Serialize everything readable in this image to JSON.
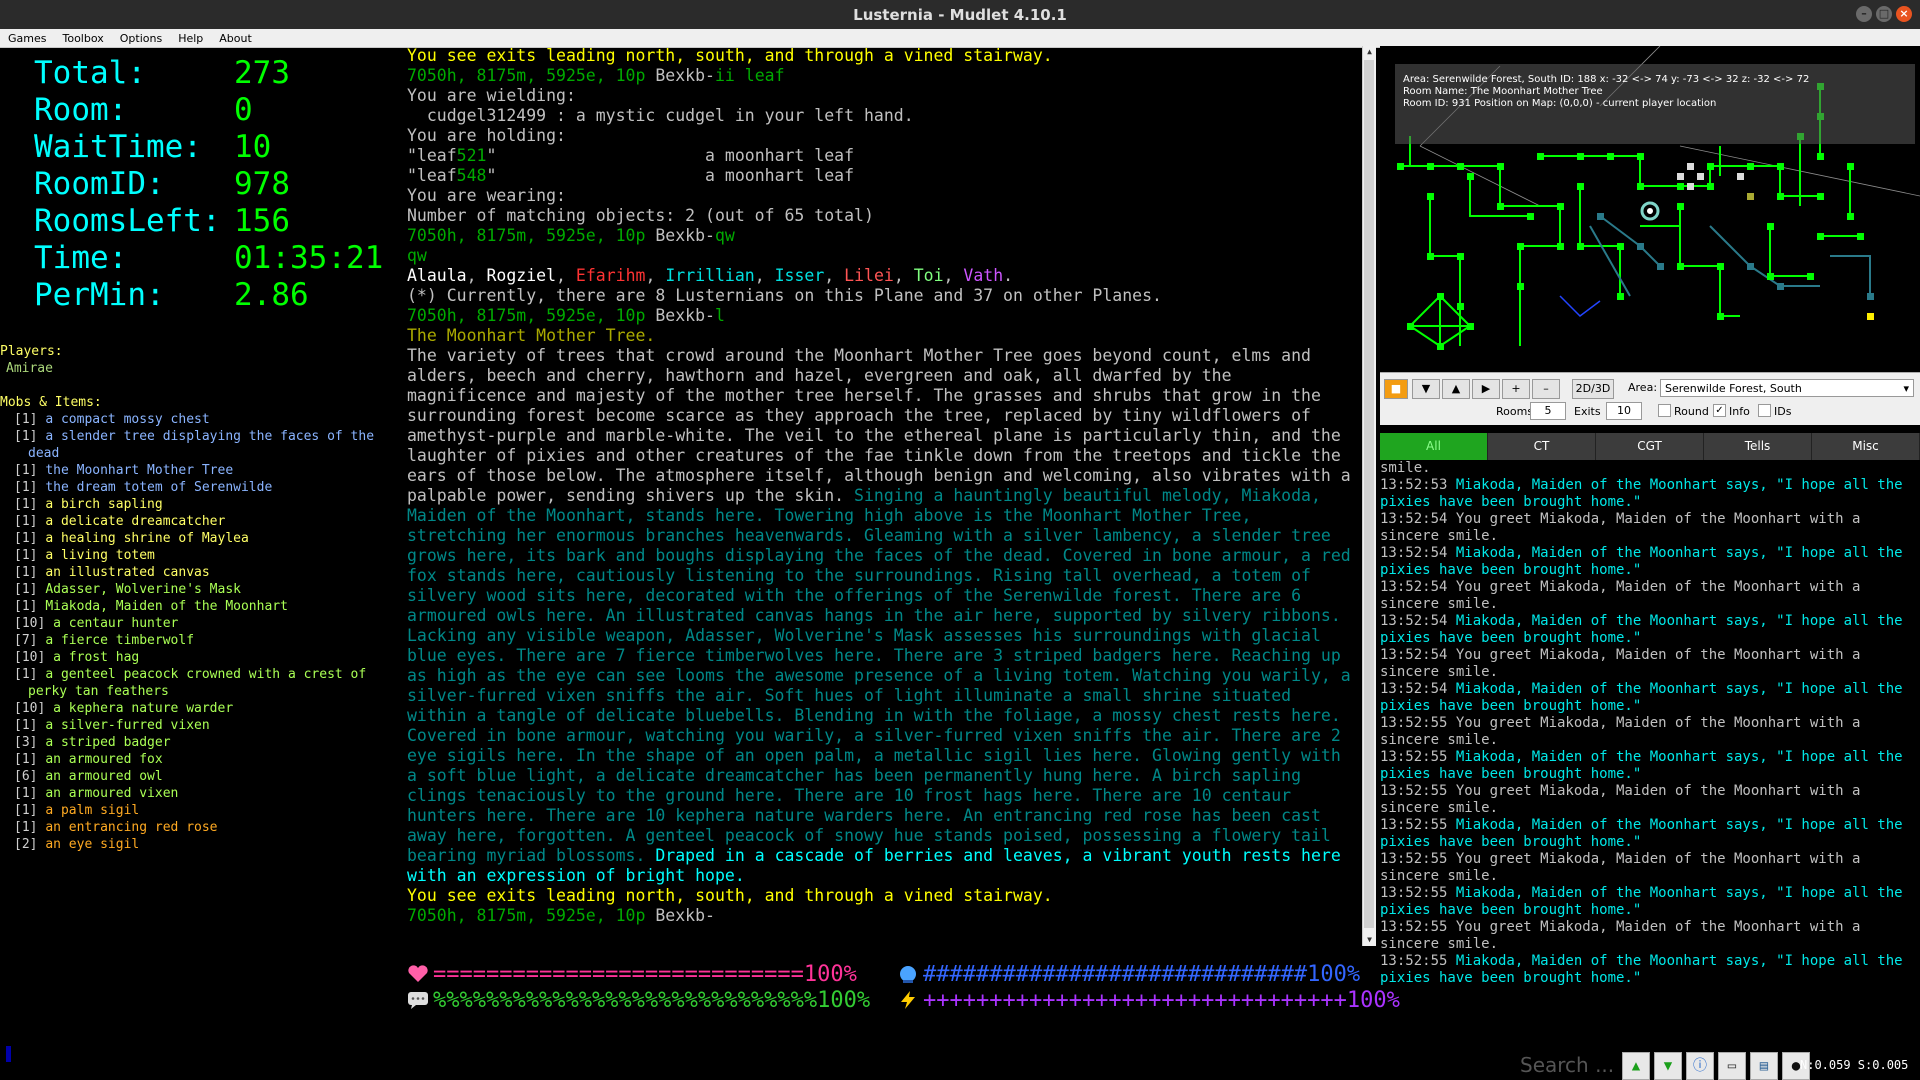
{
  "window": {
    "title": "Lusternia - Mudlet 4.10.1"
  },
  "menu": [
    "Games",
    "Toolbox",
    "Options",
    "Help",
    "About"
  ],
  "stats": [
    {
      "label": "Total:",
      "value": "273"
    },
    {
      "label": "Room:",
      "value": "0"
    },
    {
      "label": "WaitTime:",
      "value": "10"
    },
    {
      "label": "RoomID:",
      "value": "978"
    },
    {
      "label": "RoomsLeft:",
      "value": "156"
    },
    {
      "label": "Time:",
      "value": "01:35:21"
    },
    {
      "label": "PerMin:",
      "value": "2.86"
    }
  ],
  "players": {
    "header": "Players:",
    "list": [
      "Amirae"
    ]
  },
  "mobs": {
    "header": "Mobs & Items:",
    "items": [
      {
        "count": "[1]",
        "name": "a compact mossy chest",
        "color": "blue"
      },
      {
        "count": "[1]",
        "name": "a slender tree displaying the faces of the dead",
        "color": "blue"
      },
      {
        "count": "[1]",
        "name": "the Moonhart Mother Tree",
        "color": "blue"
      },
      {
        "count": "[1]",
        "name": "the dream totem of Serenwilde",
        "color": "blue"
      },
      {
        "count": "[1]",
        "name": "a birch sapling",
        "color": "yellow"
      },
      {
        "count": "[1]",
        "name": "a delicate dreamcatcher",
        "color": "yellow"
      },
      {
        "count": "[1]",
        "name": "a healing shrine of Maylea",
        "color": "yellow"
      },
      {
        "count": "[1]",
        "name": "a living totem",
        "color": "yellow"
      },
      {
        "count": "[1]",
        "name": "an illustrated canvas",
        "color": "yellow"
      },
      {
        "count": "[1]",
        "name": "Adasser, Wolverine's Mask",
        "color": "lime"
      },
      {
        "count": "[1]",
        "name": "Miakoda, Maiden of the Moonhart",
        "color": "lime"
      },
      {
        "count": "[10]",
        "name": "a centaur hunter",
        "color": "lime"
      },
      {
        "count": "[7]",
        "name": "a fierce timberwolf",
        "color": "lime"
      },
      {
        "count": "[10]",
        "name": "a frost hag",
        "color": "lime"
      },
      {
        "count": "[1]",
        "name": "a genteel peacock crowned with a crest of perky tan feathers",
        "color": "lime"
      },
      {
        "count": "[10]",
        "name": "a kephera nature warder",
        "color": "lime"
      },
      {
        "count": "[1]",
        "name": "a silver-furred vixen",
        "color": "lime"
      },
      {
        "count": "[3]",
        "name": "a striped badger",
        "color": "lime"
      },
      {
        "count": "[1]",
        "name": "an armoured fox",
        "color": "lime"
      },
      {
        "count": "[6]",
        "name": "an armoured owl",
        "color": "lime"
      },
      {
        "count": "[1]",
        "name": "an armoured vixen",
        "color": "lime"
      },
      {
        "count": "[1]",
        "name": "a palm sigil",
        "color": "orange"
      },
      {
        "count": "[1]",
        "name": "an entrancing red rose",
        "color": "orange"
      },
      {
        "count": "[2]",
        "name": "an eye sigil",
        "color": "orange"
      }
    ]
  },
  "console": {
    "lines": [
      [
        {
          "t": "You see exits leading north, south, and through a vined stairway.",
          "c": "y"
        }
      ],
      [
        {
          "t": "7050h, 8175m, 5925e, 10p ",
          "c": "g"
        },
        {
          "t": "Bexkb-",
          "c": "w"
        },
        {
          "t": "ii leaf",
          "c": "dg"
        }
      ],
      [
        {
          "t": "You are wielding:",
          "c": "w"
        }
      ],
      [
        {
          "t": "  cudgel312499 : a mystic cudgel in your left hand.",
          "c": "w"
        }
      ],
      [
        {
          "t": "You are holding:",
          "c": "w"
        }
      ],
      [
        {
          "t": "\"leaf",
          "c": "w"
        },
        {
          "t": "521",
          "c": "dg"
        },
        {
          "t": "\"                     a moonhart leaf",
          "c": "w"
        }
      ],
      [
        {
          "t": "\"leaf",
          "c": "w"
        },
        {
          "t": "548",
          "c": "dg"
        },
        {
          "t": "\"                     a moonhart leaf",
          "c": "w"
        }
      ],
      [
        {
          "t": "You are wearing:",
          "c": "w"
        }
      ],
      [
        {
          "t": "Number of matching objects: 2 (out of 65 total)",
          "c": "w"
        }
      ],
      [
        {
          "t": "7050h, 8175m, 5925e, 10p ",
          "c": "g"
        },
        {
          "t": "Bexkb-",
          "c": "w"
        },
        {
          "t": "qw",
          "c": "dg"
        }
      ],
      [
        {
          "t": "qw",
          "c": "dg"
        }
      ],
      [
        {
          "t": "Alaula",
          "c": "wb"
        },
        {
          "t": ", ",
          "c": "w"
        },
        {
          "t": "Rogziel",
          "c": "wb"
        },
        {
          "t": ", ",
          "c": "w"
        },
        {
          "t": "Efarihm",
          "c": "r"
        },
        {
          "t": ", ",
          "c": "w"
        },
        {
          "t": "Irrillian",
          "c": "cy"
        },
        {
          "t": ", ",
          "c": "w"
        },
        {
          "t": "Isser",
          "c": "cy"
        },
        {
          "t": ", ",
          "c": "w"
        },
        {
          "t": "Lilei",
          "c": "lr"
        },
        {
          "t": ", ",
          "c": "w"
        },
        {
          "t": "Toi",
          "c": "gr"
        },
        {
          "t": ", ",
          "c": "w"
        },
        {
          "t": "Vath",
          "c": "pu"
        },
        {
          "t": ".",
          "c": "w"
        }
      ],
      [
        {
          "t": "(*) Currently, there are 8 Lusternians on this Plane and 37 on other Planes.",
          "c": "w"
        }
      ],
      [
        {
          "t": "7050h, 8175m, 5925e, 10p ",
          "c": "g"
        },
        {
          "t": "Bexkb-",
          "c": "w"
        },
        {
          "t": "l",
          "c": "dg"
        }
      ],
      [
        {
          "t": "The Moonhart Mother Tree.",
          "c": "o"
        }
      ],
      [
        {
          "t": "The variety of trees that crowd around the Moonhart Mother Tree goes beyond count, elms and alders, beech and cherry, hawthorn and hazel, evergreen and oak, all dwarfed by the magnificence and majesty of the mother tree herself. The grasses and shrubs that grow in the surrounding forest become scarce as they approach the tree, replaced by tiny wildflowers of amethyst-purple and marble-white. The veil to the ethereal plane is particularly thin, and the laughter of pixies and other creatures of the fae tinkle down from the treetops and tickle the ears of those below. The atmosphere itself, although benign and welcoming, also vibrates with a palpable power, sending shivers up the skin. ",
          "c": "w"
        },
        {
          "t": "Singing a hauntingly beautiful melody, Miakoda, Maiden of the Moonhart, stands here. Towering high above is the Moonhart Mother Tree, stretching her enormous branches heavenwards. Gleaming with a silver lambency, a slender tree grows here, its bark and boughs displaying the faces of the dead. Covered in bone armour, a red fox stands here, cautiously listening to the surroundings. Rising tall overhead, a totem of silvery wood sits here, decorated with the offerings of the Serenwilde forest. There are 6 armoured owls here. An illustrated canvas hangs in the air here, supported by silvery ribbons. Lacking any visible weapon, Adasser, Wolverine's Mask assesses his surroundings with glacial blue eyes. There are 7 fierce timberwolves here. There are 3 striped badgers here. Reaching up as high as the eye can see looms the awesome presence of a living totem. Watching you warily, a silver-furred vixen sniffs the air. Soft hues of light illuminate a small shrine situated within a tangle of delicate bluebells. Blending in with the foliage, a mossy chest rests here. Covered in bone armour, watching you warily, a silver-furred vixen sniffs the air. There are 2 eye sigils here. In the shape of an open palm, a metallic sigil lies here. Glowing gently with a soft blue light, a delicate dreamcatcher has been permanently hung here. A birch sapling clings tenaciously to the ground here. There are 10 frost hags here. There are 10 centaur hunters here. There are 10 kephera nature warders here. An entrancing red rose has been cast away here, forgotten. A genteel peacock of snowy hue stands poised, possessing a flowery tail bearing myriad blossoms. ",
          "c": "t"
        },
        {
          "t": "Draped in a cascade of berries and leaves, a vibrant youth rests here with an expression of bright hope.",
          "c": "c"
        }
      ],
      [
        {
          "t": "You see exits leading north, south, and through a vined stairway.",
          "c": "y"
        }
      ],
      [
        {
          "t": "7050h, 8175m, 5925e, 10p ",
          "c": "g"
        },
        {
          "t": "Bexkb-",
          "c": "w"
        }
      ]
    ]
  },
  "gauges": {
    "health": {
      "bar": "============================",
      "pct": "100%",
      "value": 1.0,
      "color": "#ff3399"
    },
    "mana": {
      "bar": "#############################",
      "pct": "100%",
      "value": 1.0,
      "color": "#3366ff"
    },
    "ego": {
      "bar": "%%%%%%%%%%%%%%%%%%%%%%%%%%%%%",
      "pct": "100%",
      "value": 1.0,
      "color": "#33cc33"
    },
    "power": {
      "bar": "++++++++++++++++++++++++++++++++",
      "pct": "100%",
      "value": 1.0,
      "color": "#aa33ff"
    }
  },
  "mapper": {
    "info1": "Area: Serenwilde Forest, South ID: 188 x: -32 <-> 74 y: -73 <-> 32 z: -32 <-> 72",
    "info2": "Room Name: The Moonhart Mother Tree",
    "info3": "Room ID: 931 Position on Map: (0,0,0) - current player location",
    "mode": "2D/3D",
    "area_label": "Area:",
    "area_value": "Serenwilde Forest, South",
    "rooms_label": "Rooms",
    "rooms_value": "5",
    "exits_label": "Exits",
    "exits_value": "10",
    "round_label": "Round",
    "info_label": "Info",
    "ids_label": "IDs"
  },
  "chat_tabs": [
    "All",
    "CT",
    "CGT",
    "Tells",
    "Misc"
  ],
  "chat": [
    {
      "time": "",
      "text": "smile.",
      "kind": "greet"
    },
    {
      "time": "13:52:53",
      "text": "Miakoda, Maiden of the Moonhart says, \"I hope all the pixies have been brought home.\"",
      "kind": "say"
    },
    {
      "time": "13:52:54",
      "text": "You greet Miakoda, Maiden of the Moonhart with a sincere smile.",
      "kind": "greet"
    },
    {
      "time": "13:52:54",
      "text": "Miakoda, Maiden of the Moonhart says, \"I hope all the pixies have been brought home.\"",
      "kind": "say"
    },
    {
      "time": "13:52:54",
      "text": "You greet Miakoda, Maiden of the Moonhart with a sincere smile.",
      "kind": "greet"
    },
    {
      "time": "13:52:54",
      "text": "Miakoda, Maiden of the Moonhart says, \"I hope all the pixies have been brought home.\"",
      "kind": "say"
    },
    {
      "time": "13:52:54",
      "text": "You greet Miakoda, Maiden of the Moonhart with a sincere smile.",
      "kind": "greet"
    },
    {
      "time": "13:52:54",
      "text": "Miakoda, Maiden of the Moonhart says, \"I hope all the pixies have been brought home.\"",
      "kind": "say"
    },
    {
      "time": "13:52:55",
      "text": "You greet Miakoda, Maiden of the Moonhart with a sincere smile.",
      "kind": "greet"
    },
    {
      "time": "13:52:55",
      "text": "Miakoda, Maiden of the Moonhart says, \"I hope all the pixies have been brought home.\"",
      "kind": "say"
    },
    {
      "time": "13:52:55",
      "text": "You greet Miakoda, Maiden of the Moonhart with a sincere smile.",
      "kind": "greet"
    },
    {
      "time": "13:52:55",
      "text": "Miakoda, Maiden of the Moonhart says, \"I hope all the pixies have been brought home.\"",
      "kind": "say"
    },
    {
      "time": "13:52:55",
      "text": "You greet Miakoda, Maiden of the Moonhart with a sincere smile.",
      "kind": "greet"
    },
    {
      "time": "13:52:55",
      "text": "Miakoda, Maiden of the Moonhart says, \"I hope all the pixies have been brought home.\"",
      "kind": "say"
    },
    {
      "time": "13:52:55",
      "text": "You greet Miakoda, Maiden of the Moonhart with a sincere smile.",
      "kind": "greet"
    },
    {
      "time": "13:52:55",
      "text": "Miakoda, Maiden of the Moonhart says, \"I hope all the pixies have been brought home.\"",
      "kind": "say"
    }
  ],
  "statusbar": {
    "search_placeholder": "Search ...",
    "net": "N:0.059 S:0.005"
  },
  "icons": [
    "heart-icon",
    "mana-orb-icon",
    "speech-bubble-icon",
    "lightning-icon",
    "connect-up-icon",
    "connect-down-icon",
    "info-icon",
    "console-icon",
    "map-icon",
    "avatar-icon"
  ]
}
